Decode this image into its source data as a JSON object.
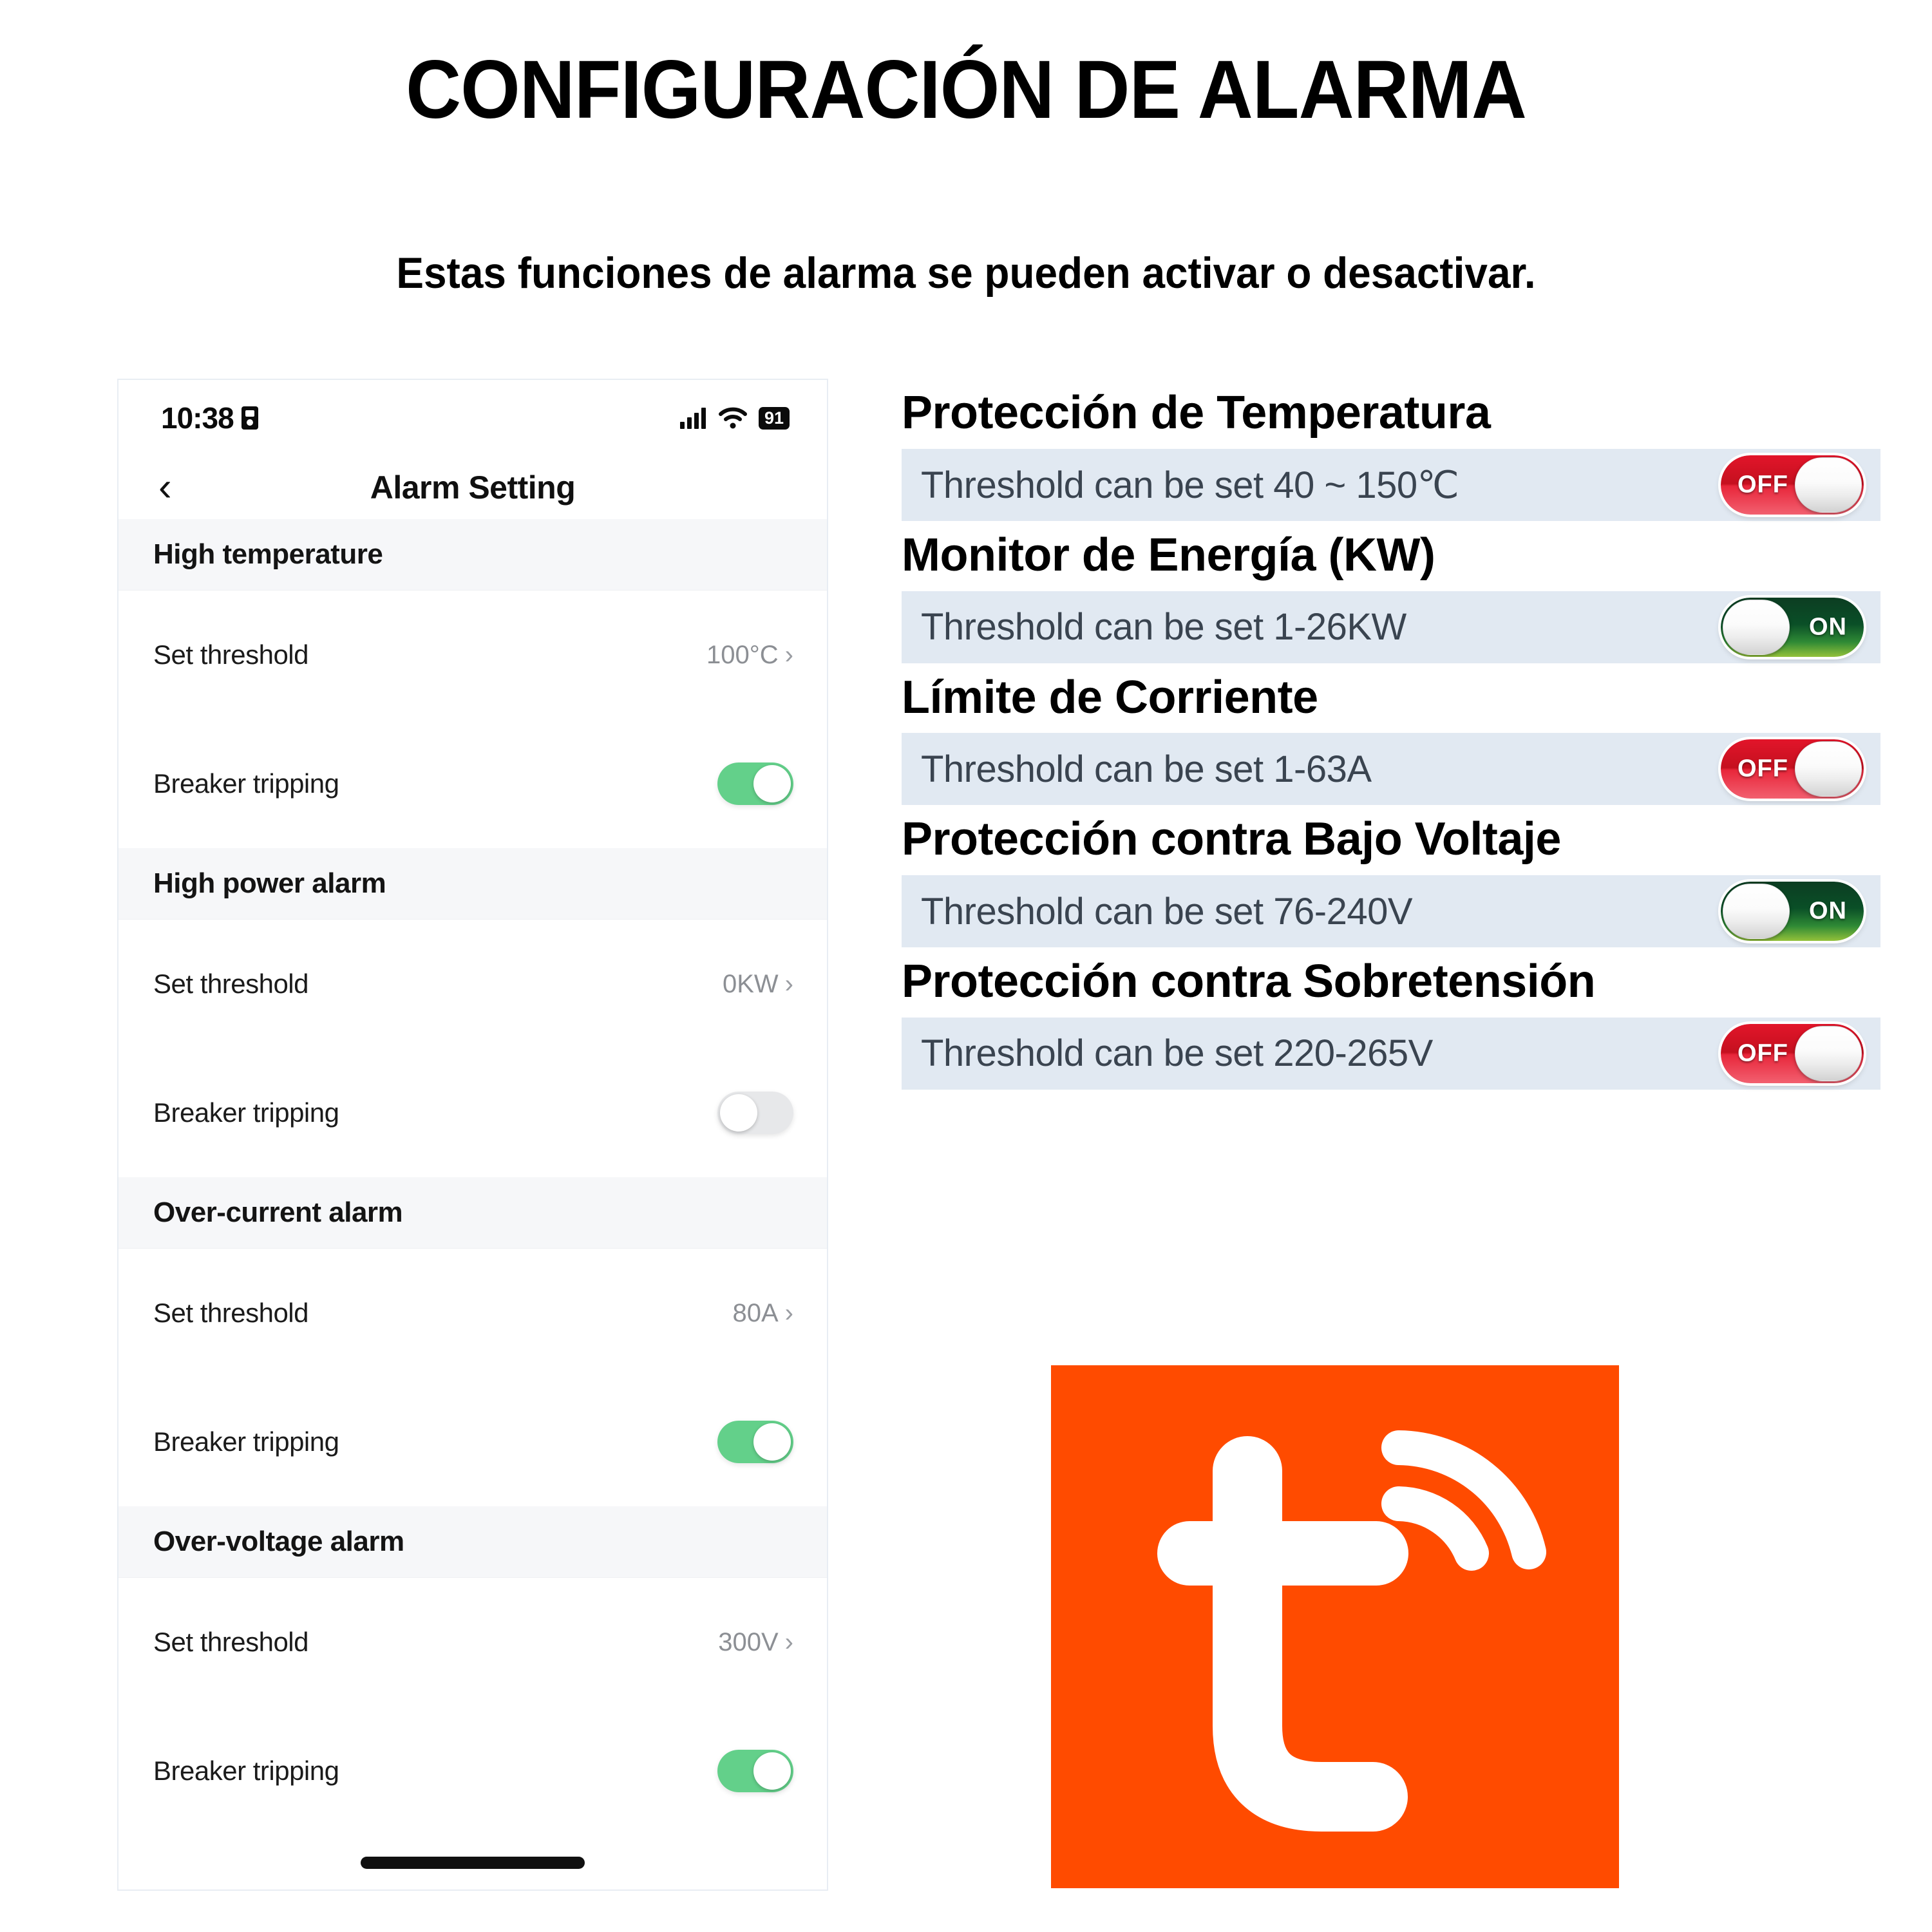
{
  "page": {
    "title": "CONFIGURACIÓN DE ALARMA",
    "subtitle": "Estas funciones de alarma se pueden activar o desactivar."
  },
  "colors": {
    "band_background": "#e1e9f2",
    "toggle_on_green": "#63d08a",
    "toggle_off_grey": "#e7e8ea",
    "switch_off_red": "#d5131f",
    "switch_on_green": "#0a4f27",
    "brand_orange": "#FF4B00"
  },
  "phone": {
    "status_bar": {
      "time": "10:38",
      "badge_icon": "id-card-icon",
      "signal_icon": "cellular-signal-icon",
      "wifi_icon": "wifi-icon",
      "battery_level": "91"
    },
    "nav": {
      "back_icon": "chevron-left-icon",
      "title": "Alarm Setting"
    },
    "sections": [
      {
        "header": "High temperature",
        "threshold_label": "Set threshold",
        "threshold_value": "100°C",
        "chevron_icon": "chevron-right-icon",
        "breaker_label": "Breaker tripping",
        "breaker_state": "on"
      },
      {
        "header": "High power alarm",
        "threshold_label": "Set threshold",
        "threshold_value": "0KW",
        "chevron_icon": "chevron-right-icon",
        "breaker_label": "Breaker tripping",
        "breaker_state": "off"
      },
      {
        "header": "Over-current alarm",
        "threshold_label": "Set threshold",
        "threshold_value": "80A",
        "chevron_icon": "chevron-right-icon",
        "breaker_label": "Breaker tripping",
        "breaker_state": "on"
      },
      {
        "header": "Over-voltage alarm",
        "threshold_label": "Set threshold",
        "threshold_value": "300V",
        "chevron_icon": "chevron-right-icon",
        "breaker_label": "Breaker tripping",
        "breaker_state": "on"
      }
    ]
  },
  "features": [
    {
      "title": "Protección de Temperatura",
      "threshold_text": "Threshold can be set  40 ~ 150℃",
      "switch_label": "OFF",
      "switch_state": "off"
    },
    {
      "title": "Monitor de Energía (KW)",
      "threshold_text": "Threshold can be set  1-26KW",
      "switch_label": "ON",
      "switch_state": "on"
    },
    {
      "title": "Límite de Corriente",
      "threshold_text": "Threshold can be set  1-63A",
      "switch_label": "OFF",
      "switch_state": "off"
    },
    {
      "title": "Protección contra Bajo Voltaje",
      "threshold_text": "Threshold can be set  76-240V",
      "switch_label": "ON",
      "switch_state": "on"
    },
    {
      "title": "Protección contra Sobretensión",
      "threshold_text": "Threshold can be set  220-265V",
      "switch_label": "OFF",
      "switch_state": "off"
    }
  ],
  "logo": {
    "name": "tuya-logo",
    "letter": "t"
  }
}
